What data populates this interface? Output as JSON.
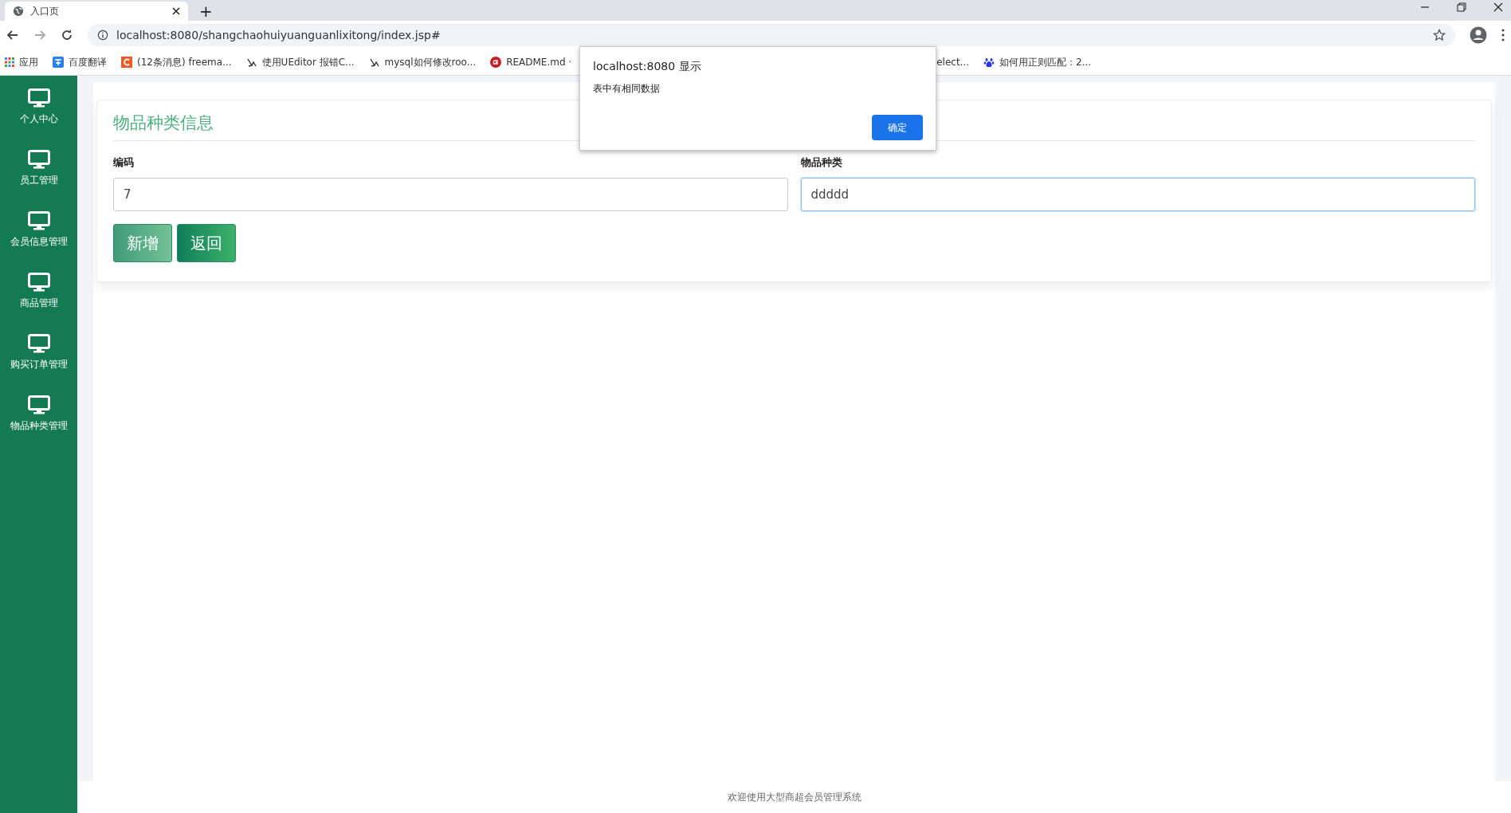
{
  "browser": {
    "tab": {
      "title": "入口页"
    },
    "new_tab": "+",
    "address": "localhost:8080/shangchaohuiyuanguanlixitong/index.jsp#",
    "bookmarks": [
      {
        "label": "应用",
        "kind": "apps"
      },
      {
        "label": "百度翻译",
        "kind": "translate"
      },
      {
        "label": "(12条消息) freema...",
        "kind": "csdn"
      },
      {
        "label": "使用UEditor 报错C...",
        "kind": "bird"
      },
      {
        "label": "mysql如何修改roo...",
        "kind": "bird"
      },
      {
        "label": "README.md ·",
        "kind": "gitee"
      },
      {
        "label": "elect...",
        "kind": "plain"
      },
      {
        "label": "如何用正则匹配：2...",
        "kind": "baidu"
      }
    ]
  },
  "sidebar": {
    "items": [
      {
        "label": "个人中心"
      },
      {
        "label": "员工管理"
      },
      {
        "label": "会员信息管理"
      },
      {
        "label": "商品管理"
      },
      {
        "label": "购买订单管理"
      },
      {
        "label": "物品种类管理"
      }
    ]
  },
  "form": {
    "title": "物品种类信息",
    "fields": [
      {
        "label": "编码",
        "value": "7",
        "focused": false
      },
      {
        "label": "物品种类",
        "value": "ddddd",
        "focused": true
      }
    ],
    "buttons": [
      {
        "label": "新增",
        "kind": "add"
      },
      {
        "label": "返回",
        "kind": "back"
      }
    ]
  },
  "footer": "欢迎使用大型商超会员管理系统",
  "dialog": {
    "title": "localhost:8080 显示",
    "message": "表中有相同数据",
    "button": "确定"
  }
}
